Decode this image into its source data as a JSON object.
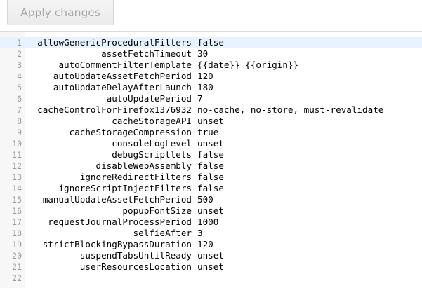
{
  "toolbar": {
    "apply_label": "Apply changes"
  },
  "editor": {
    "lines": [
      {
        "num": "1",
        "key": "allowGenericProceduralFilters",
        "value": "false"
      },
      {
        "num": "2",
        "key": "assetFetchTimeout",
        "value": "30"
      },
      {
        "num": "3",
        "key": "autoCommentFilterTemplate",
        "value": "{{date}} {{origin}}"
      },
      {
        "num": "4",
        "key": "autoUpdateAssetFetchPeriod",
        "value": "120"
      },
      {
        "num": "5",
        "key": "autoUpdateDelayAfterLaunch",
        "value": "180"
      },
      {
        "num": "6",
        "key": "autoUpdatePeriod",
        "value": "7"
      },
      {
        "num": "7",
        "key": "cacheControlForFirefox1376932",
        "value": "no-cache, no-store, must-revalidate"
      },
      {
        "num": "8",
        "key": "cacheStorageAPI",
        "value": "unset"
      },
      {
        "num": "9",
        "key": "cacheStorageCompression",
        "value": "true"
      },
      {
        "num": "10",
        "key": "consoleLogLevel",
        "value": "unset"
      },
      {
        "num": "11",
        "key": "debugScriptlets",
        "value": "false"
      },
      {
        "num": "12",
        "key": "disableWebAssembly",
        "value": "false"
      },
      {
        "num": "13",
        "key": "ignoreRedirectFilters",
        "value": "false"
      },
      {
        "num": "14",
        "key": "ignoreScriptInjectFilters",
        "value": "false"
      },
      {
        "num": "15",
        "key": "manualUpdateAssetFetchPeriod",
        "value": "500"
      },
      {
        "num": "16",
        "key": "popupFontSize",
        "value": "unset"
      },
      {
        "num": "17",
        "key": "requestJournalProcessPeriod",
        "value": "1000"
      },
      {
        "num": "18",
        "key": "selfieAfter",
        "value": "3"
      },
      {
        "num": "19",
        "key": "strictBlockingBypassDuration",
        "value": "120"
      },
      {
        "num": "20",
        "key": "suspendTabsUntilReady",
        "value": "unset"
      },
      {
        "num": "21",
        "key": "userResourcesLocation",
        "value": "unset"
      },
      {
        "num": "22",
        "key": "",
        "value": ""
      }
    ]
  }
}
